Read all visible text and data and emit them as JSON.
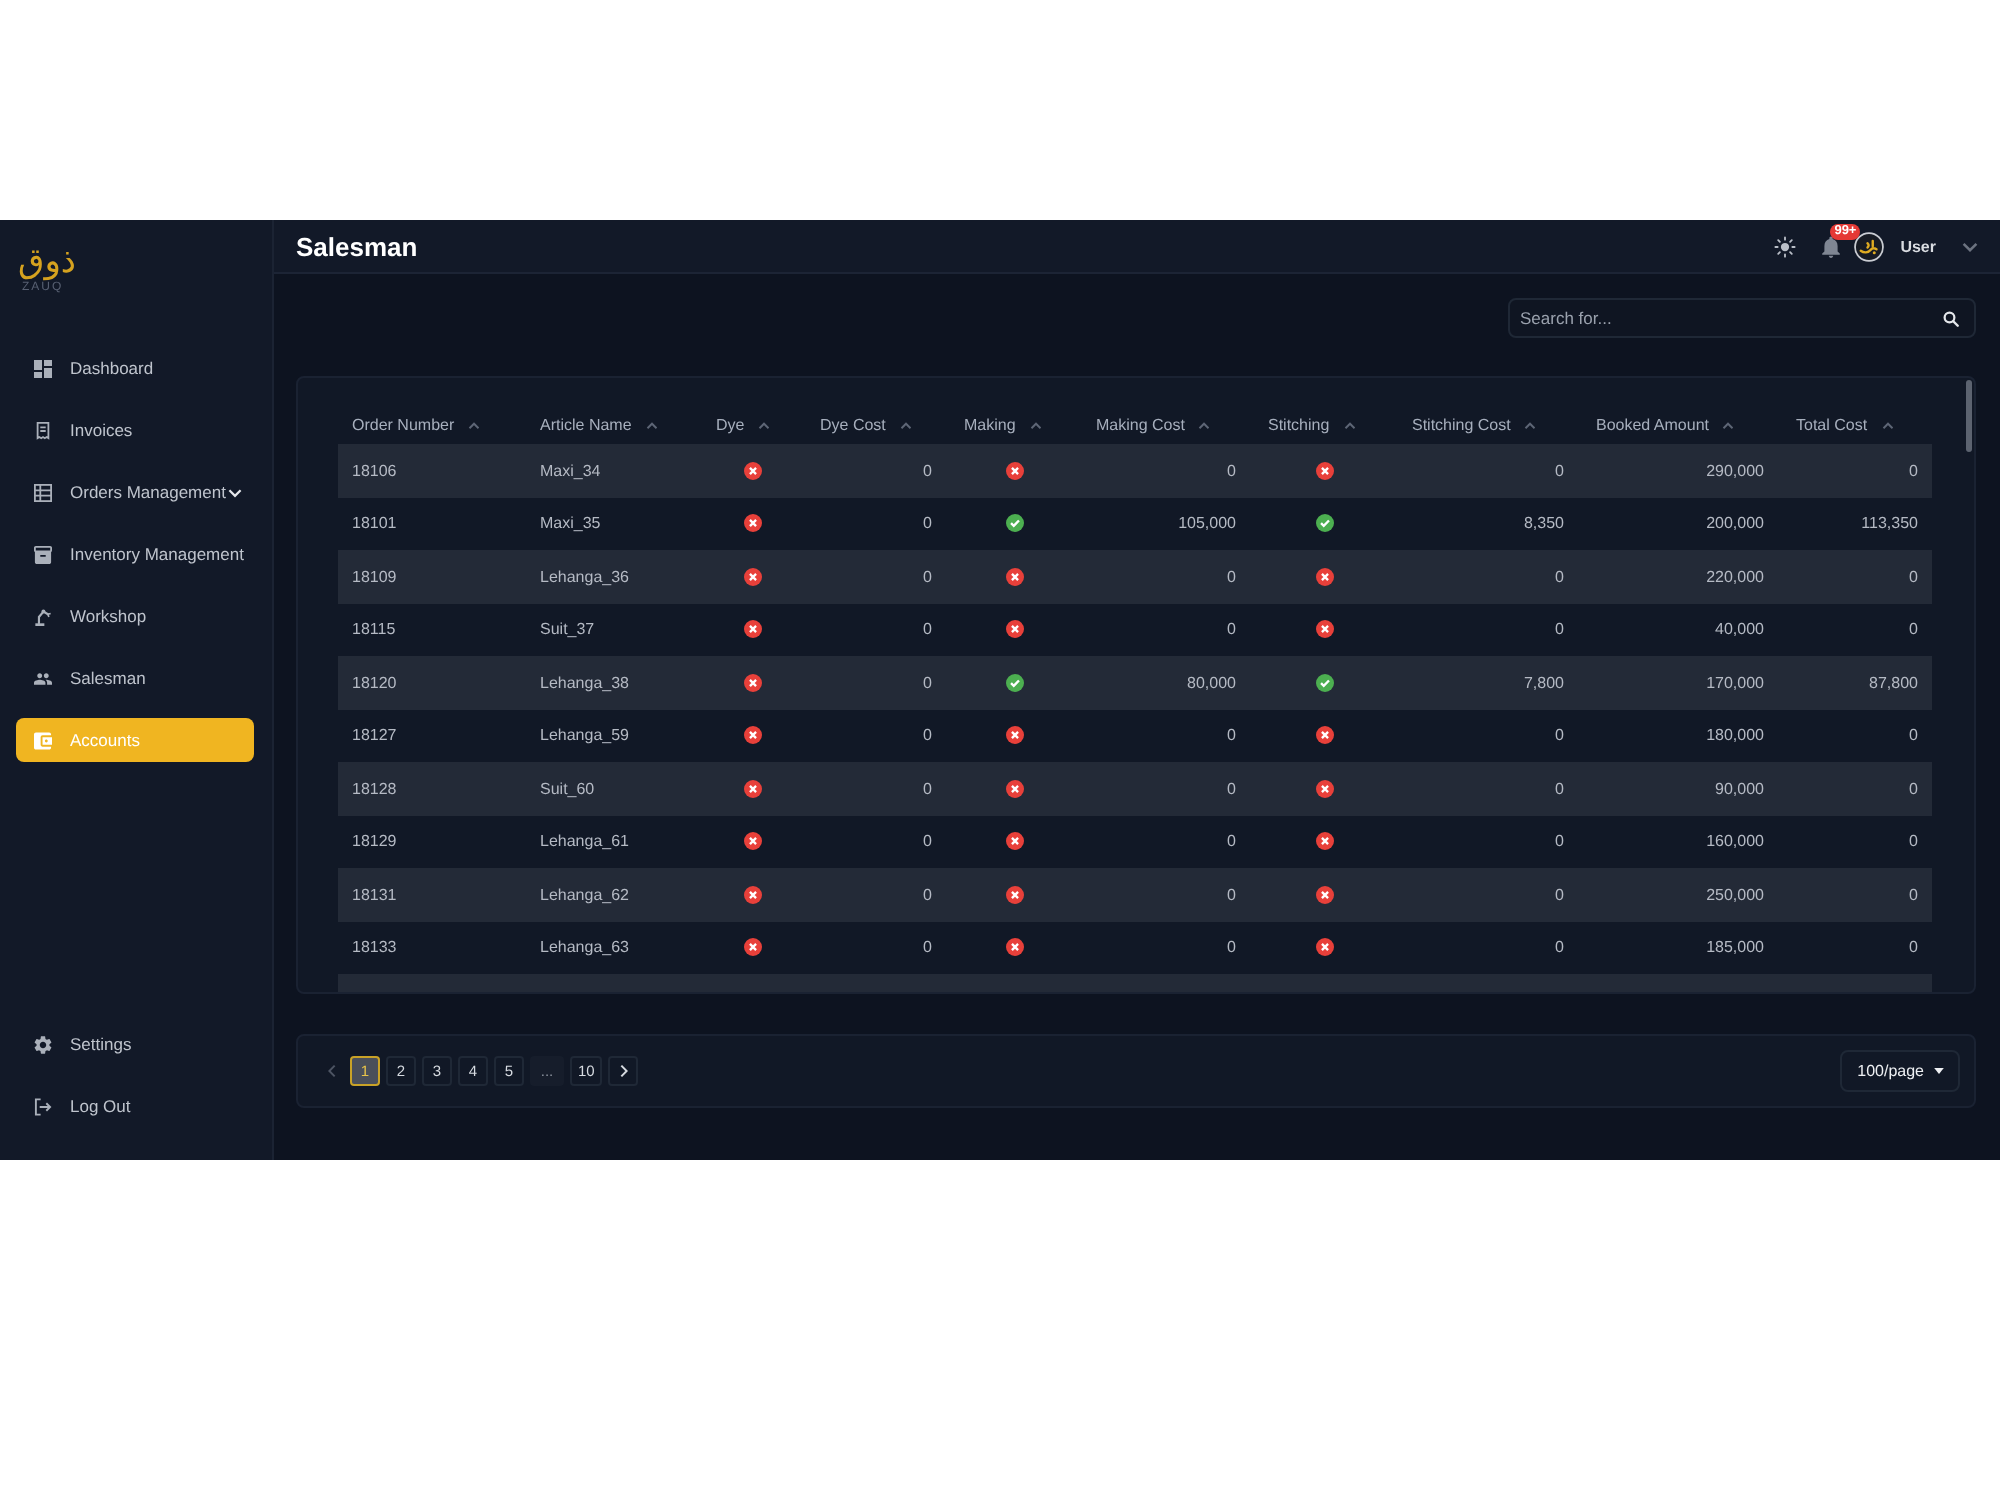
{
  "logo": {
    "wordmark": "ذوق",
    "subtitle": "ZAUQ"
  },
  "sidebar": {
    "items": [
      {
        "label": "Dashboard",
        "kind": "link",
        "selected": false
      },
      {
        "label": "Invoices",
        "kind": "link",
        "selected": false
      },
      {
        "label": "Orders Management",
        "kind": "submenu",
        "selected": false
      },
      {
        "label": "Inventory Management",
        "kind": "link",
        "selected": false
      },
      {
        "label": "Workshop",
        "kind": "link",
        "selected": false
      },
      {
        "label": "Salesman",
        "kind": "link",
        "selected": false
      },
      {
        "label": "Accounts",
        "kind": "link",
        "selected": true
      }
    ],
    "footer_items": [
      {
        "label": "Settings",
        "selected": false
      },
      {
        "label": "Log Out",
        "selected": false
      }
    ]
  },
  "header": {
    "title": "Salesman",
    "notification_count": "99+",
    "user_name": "User"
  },
  "search": {
    "placeholder": "Search for..."
  },
  "table": {
    "columns": [
      {
        "label": "Order Number",
        "kind": "text"
      },
      {
        "label": "Article Name",
        "kind": "text"
      },
      {
        "label": "Dye",
        "kind": "status"
      },
      {
        "label": "Dye Cost",
        "kind": "amount"
      },
      {
        "label": "Making",
        "kind": "status"
      },
      {
        "label": "Making Cost",
        "kind": "amount"
      },
      {
        "label": "Stitching",
        "kind": "status"
      },
      {
        "label": "Stitching Cost",
        "kind": "amount"
      },
      {
        "label": "Booked Amount",
        "kind": "amount"
      },
      {
        "label": "Total Cost",
        "kind": "amount"
      }
    ],
    "rows": [
      {
        "cells": [
          "18106",
          "Maxi_34",
          {
            "done": false
          },
          "0",
          {
            "done": false
          },
          "0",
          {
            "done": false
          },
          "0",
          "290,000",
          "0"
        ]
      },
      {
        "cells": [
          "18101",
          "Maxi_35",
          {
            "done": false
          },
          "0",
          {
            "done": true
          },
          "105,000",
          {
            "done": true
          },
          "8,350",
          "200,000",
          "113,350"
        ]
      },
      {
        "cells": [
          "18109",
          "Lehanga_36",
          {
            "done": false
          },
          "0",
          {
            "done": false
          },
          "0",
          {
            "done": false
          },
          "0",
          "220,000",
          "0"
        ]
      },
      {
        "cells": [
          "18115",
          "Suit_37",
          {
            "done": false
          },
          "0",
          {
            "done": false
          },
          "0",
          {
            "done": false
          },
          "0",
          "40,000",
          "0"
        ]
      },
      {
        "cells": [
          "18120",
          "Lehanga_38",
          {
            "done": false
          },
          "0",
          {
            "done": true
          },
          "80,000",
          {
            "done": true
          },
          "7,800",
          "170,000",
          "87,800"
        ]
      },
      {
        "cells": [
          "18127",
          "Lehanga_59",
          {
            "done": false
          },
          "0",
          {
            "done": false
          },
          "0",
          {
            "done": false
          },
          "0",
          "180,000",
          "0"
        ]
      },
      {
        "cells": [
          "18128",
          "Suit_60",
          {
            "done": false
          },
          "0",
          {
            "done": false
          },
          "0",
          {
            "done": false
          },
          "0",
          "90,000",
          "0"
        ]
      },
      {
        "cells": [
          "18129",
          "Lehanga_61",
          {
            "done": false
          },
          "0",
          {
            "done": false
          },
          "0",
          {
            "done": false
          },
          "0",
          "160,000",
          "0"
        ]
      },
      {
        "cells": [
          "18131",
          "Lehanga_62",
          {
            "done": false
          },
          "0",
          {
            "done": false
          },
          "0",
          {
            "done": false
          },
          "0",
          "250,000",
          "0"
        ]
      },
      {
        "cells": [
          "18133",
          "Lehanga_63",
          {
            "done": false
          },
          "0",
          {
            "done": false
          },
          "0",
          {
            "done": false
          },
          "0",
          "185,000",
          "0"
        ]
      }
    ]
  },
  "pagination": {
    "prev": {
      "disabled": true
    },
    "pages": [
      {
        "label": "1",
        "kind": "page",
        "selected": true
      },
      {
        "label": "2",
        "kind": "page",
        "selected": false
      },
      {
        "label": "3",
        "kind": "page",
        "selected": false
      },
      {
        "label": "4",
        "kind": "page",
        "selected": false
      },
      {
        "label": "5",
        "kind": "page",
        "selected": false
      },
      {
        "label": "...",
        "kind": "ellipsis",
        "selected": false
      },
      {
        "label": "10",
        "kind": "page",
        "selected": false
      }
    ],
    "next": {
      "disabled": false
    },
    "page_size": "100/page"
  }
}
